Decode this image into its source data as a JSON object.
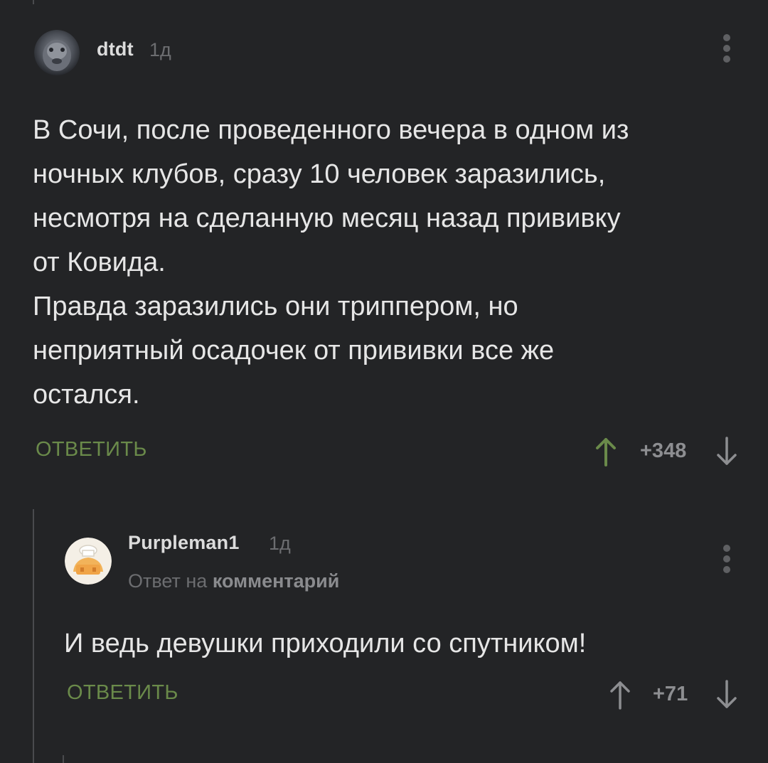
{
  "comments": [
    {
      "username": "dtdt",
      "time": "1д",
      "text": "В Сочи, после проведенного вечера в одном из\nночных клубов, сразу 10 человек заразились,\nнесмотря на сделанную месяц назад прививку\nот Ковида.\nПравда заразились они триппером, но\nнеприятный осадочек от прививки все же\nостался.",
      "reply_label": "ОТВЕТИТЬ",
      "rating": "+348",
      "upvoted": true
    },
    {
      "username": "Purpleman1",
      "time": "1д",
      "reply_to_prefix": "Ответ на",
      "reply_to_link": "комментарий",
      "text": "И ведь девушки приходили со спутником!",
      "reply_label": "ОТВЕТИТЬ",
      "rating": "+71",
      "upvoted": false
    }
  ],
  "colors": {
    "background": "#232426",
    "accent_green": "#6a8a4a",
    "muted": "#6c6d70"
  },
  "icons": {
    "upvote": "arrow-up-icon",
    "downvote": "arrow-down-icon",
    "more": "more-vertical-icon"
  }
}
